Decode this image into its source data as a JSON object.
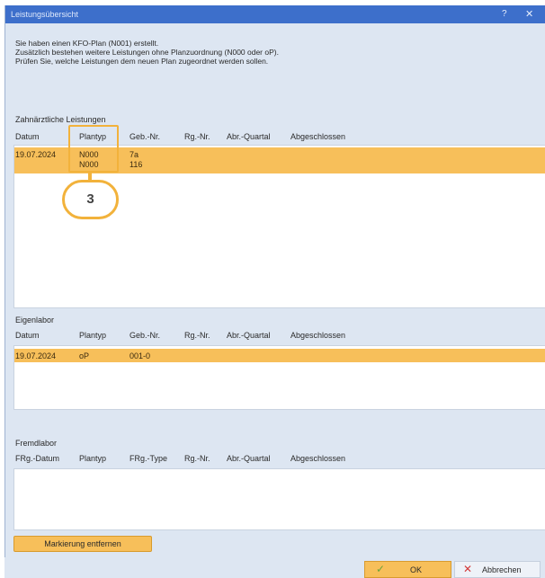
{
  "window": {
    "title": "Leistungsübersicht",
    "help_label": "?",
    "close_label": "✕"
  },
  "intro": {
    "line1": "Sie haben einen KFO-Plan (N001) erstellt.",
    "line2": "Zusätzlich bestehen weitere Leistungen ohne Planzuordnung (N000 oder oP).",
    "line3": "Prüfen Sie, welche Leistungen dem neuen Plan zugeordnet werden sollen."
  },
  "zahnaerztlich": {
    "title": "Zahnärztliche Leistungen",
    "columns": [
      "Datum",
      "Plantyp",
      "Geb.-Nr.",
      "Rg.-Nr.",
      "Abr.-Quartal",
      "Abgeschlossen"
    ],
    "rows": [
      {
        "datum": "19.07.2024",
        "plantyp": "N000",
        "gebnr": "7a"
      },
      {
        "datum": "",
        "plantyp": "N000",
        "gebnr": "116"
      }
    ]
  },
  "callout": {
    "number": "3"
  },
  "eigenlabor": {
    "title": "Eigenlabor",
    "columns": [
      "Datum",
      "Plantyp",
      "Geb.-Nr.",
      "Rg.-Nr.",
      "Abr.-Quartal",
      "Abgeschlossen"
    ],
    "rows": [
      {
        "datum": "19.07.2024",
        "plantyp": "oP",
        "gebnr": "001-0"
      }
    ]
  },
  "fremdlabor": {
    "title": "Fremdlabor",
    "columns": [
      "FRg.-Datum",
      "Plantyp",
      "FRg.-Type",
      "Rg.-Nr.",
      "Abr.-Quartal",
      "Abgeschlossen"
    ],
    "rows": []
  },
  "buttons": {
    "markierung": "Markierung entfernen",
    "ok": "OK",
    "ok_icon": "check-icon",
    "abbrechen": "Abbrechen",
    "abbrechen_icon": "x-icon"
  },
  "colors": {
    "titlebar": "#3d6fcb",
    "selection": "#f7bf5a",
    "callout": "#f2b23b"
  }
}
